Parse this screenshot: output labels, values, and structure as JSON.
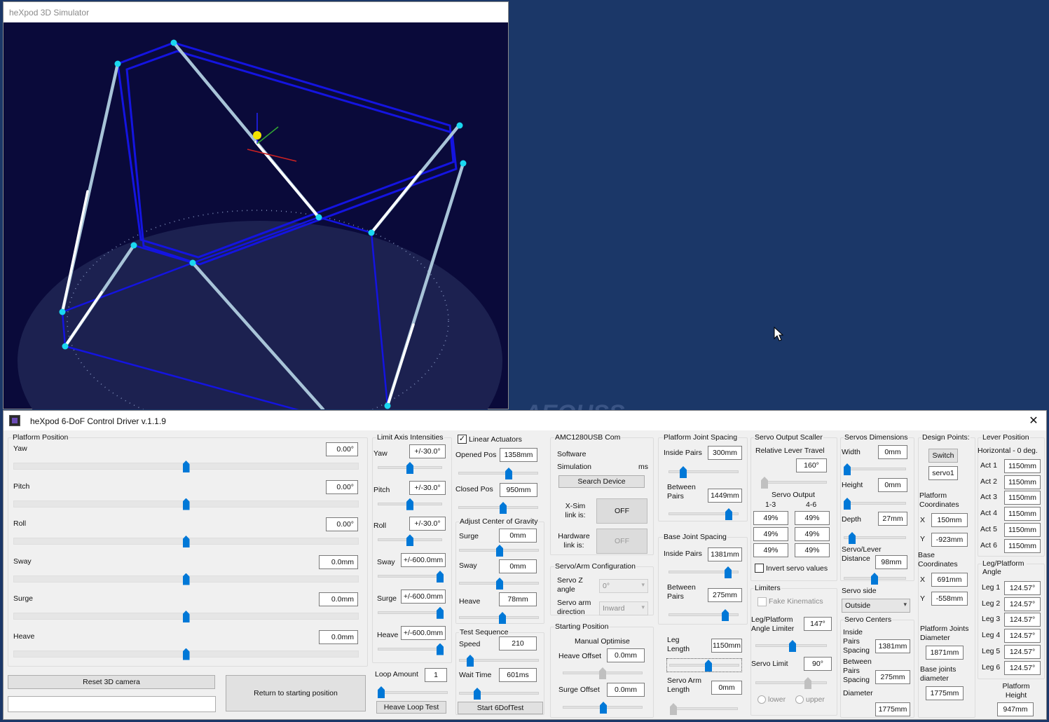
{
  "sim": {
    "title": "heXpod 3D Simulator"
  },
  "desktop": {
    "partial_text": "AEQUSS"
  },
  "ctl": {
    "title": "heXpod 6-DoF Control Driver v.1.1.9",
    "close": "✕"
  },
  "platform": {
    "group": "Platform Position",
    "rows": [
      {
        "label": "Yaw",
        "value": "0.00°"
      },
      {
        "label": "Pitch",
        "value": "0.00°"
      },
      {
        "label": "Roll",
        "value": "0.00°"
      },
      {
        "label": "Sway",
        "value": "0.0mm"
      },
      {
        "label": "Surge",
        "value": "0.0mm"
      },
      {
        "label": "Heave",
        "value": "0.0mm"
      }
    ],
    "slider_level": 0.5
  },
  "buttons": {
    "reset": "Reset 3D camera",
    "return": "Return to starting position",
    "status": ""
  },
  "limits": {
    "group": "Limit Axis Intensities",
    "rows": [
      {
        "label": "Yaw",
        "value": "+/-30.0°"
      },
      {
        "label": "Pitch",
        "value": "+/-30.0°"
      },
      {
        "label": "Roll",
        "value": "+/-30.0°"
      },
      {
        "label": "Sway",
        "value": "+/-600.0mm"
      },
      {
        "label": "Surge",
        "value": "+/-600.0mm"
      },
      {
        "label": "Heave",
        "value": "+/-600.0mm"
      }
    ]
  },
  "loop": {
    "label": "Loop Amount",
    "value": "1",
    "button": "Heave  Loop Test"
  },
  "linear": {
    "check_label": "Linear Actuators",
    "checked": true,
    "opened_label": "Opened Pos",
    "opened": "1358mm",
    "closed_label": "Closed Pos",
    "closed": "950mm"
  },
  "cog": {
    "group": "Adjust Center of Gravity",
    "surge_label": "Surge",
    "surge": "0mm",
    "sway_label": "Sway",
    "sway": "0mm",
    "heave_label": "Heave",
    "heave": "78mm"
  },
  "test": {
    "group": "Test Sequence",
    "speed_label": "Speed",
    "speed": "210",
    "wait_label": "Wait Time",
    "wait": "601ms",
    "button": "Start 6DofTest"
  },
  "amc": {
    "group": "AMC1280USB Com",
    "software": "Software",
    "simulation": "Simulation",
    "ms": "ms",
    "search": "Search Device",
    "xsim_label": "X-Sim link is:",
    "xsim": "OFF",
    "hw_label": "Hardware link is:",
    "hw": "OFF"
  },
  "servoarm": {
    "group": "Servo/Arm Configuration",
    "z_label": "Servo Z angle",
    "z": "0°",
    "dir_label": "Servo arm direction",
    "dir": "Inward"
  },
  "start": {
    "group": "Starting Position",
    "manual": "Manual Optimise",
    "heave_label": "Heave Offset",
    "heave": "0.0mm",
    "surge_label": "Surge Offset",
    "surge": "0.0mm"
  },
  "pjs": {
    "group": "Platform Joint Spacing",
    "inside_label": "Inside Pairs",
    "inside": "300mm",
    "between_label": "Between Pairs",
    "between": "1449mm"
  },
  "bjs": {
    "group": "Base Joint Spacing",
    "inside_label": "Inside Pairs",
    "inside": "1381mm",
    "between_label": "Between Pairs",
    "between": "275mm"
  },
  "leg": {
    "leg_label": "Leg Length",
    "leg": "1150mm",
    "arm_label": "Servo Arm Length",
    "arm": "0mm"
  },
  "scaller": {
    "group": "Servo Output Scaller",
    "rel_label": "Relative Lever Travel",
    "rel": "160°",
    "out_label": "Servo Output",
    "col1": "1-3",
    "col2": "4-6",
    "cells": [
      "49%",
      "49%",
      "49%",
      "49%",
      "49%",
      "49%"
    ],
    "invert_label": "Invert servo values"
  },
  "limiters": {
    "group": "Limiters",
    "fake_label": "Fake Kinematics",
    "angle_label": "Leg/Platform Angle Limiter",
    "angle": "147°",
    "servo_label": "Servo Limit",
    "servo": "90°",
    "lower": "lower",
    "upper": "upper"
  },
  "dims": {
    "group": "Servos Dimensions",
    "width_label": "Width",
    "width": "0mm",
    "height_label": "Height",
    "height": "0mm",
    "depth_label": "Depth",
    "depth": "27mm",
    "dist_label": "Servo/Lever Distance",
    "dist": "98mm",
    "side_label": "Servo side",
    "side": "Outside"
  },
  "centers": {
    "group": "Servo Centers",
    "inside_label": "Inside Pairs Spacing",
    "inside": "1381mm",
    "between_label": "Between Pairs Spacing",
    "between": "275mm",
    "diam_label": "Diameter",
    "diam": "1775mm"
  },
  "design": {
    "group": "Design Points:",
    "switch": "Switch",
    "servo": "servo1",
    "plat_label": "Platform Coordinates",
    "px": "150mm",
    "py": "-923mm",
    "base_label": "Base Coordinates",
    "bx": "691mm",
    "by": "-558mm",
    "x": "X",
    "y": "Y",
    "pjd_label": "Platform Joints Diameter",
    "pjd": "1871mm",
    "bjd_label": "Base joints diameter",
    "bjd": "1775mm"
  },
  "lever": {
    "group": "Lever Position",
    "horiz": "Horizontal - 0 deg.",
    "acts": [
      {
        "label": "Act 1",
        "value": "1150mm"
      },
      {
        "label": "Act 2",
        "value": "1150mm"
      },
      {
        "label": "Act 3",
        "value": "1150mm"
      },
      {
        "label": "Act 4",
        "value": "1150mm"
      },
      {
        "label": "Act 5",
        "value": "1150mm"
      },
      {
        "label": "Act 6",
        "value": "1150mm"
      }
    ],
    "lpa_label": "Leg/Platform Angle",
    "legs": [
      {
        "label": "Leg 1",
        "value": "124.57°"
      },
      {
        "label": "Leg 2",
        "value": "124.57°"
      },
      {
        "label": "Leg 3",
        "value": "124.57°"
      },
      {
        "label": "Leg 4",
        "value": "124.57°"
      },
      {
        "label": "Leg 5",
        "value": "124.57°"
      },
      {
        "label": "Leg 6",
        "value": "124.57°"
      }
    ],
    "ph_label": "Platform Height",
    "ph": "947mm"
  },
  "colors": {
    "desktop": "#1b3768",
    "accent": "#0078d7",
    "sim_bg": "#0a0a3a",
    "frame": "#1010e0",
    "leg": "#a8c4d8"
  }
}
